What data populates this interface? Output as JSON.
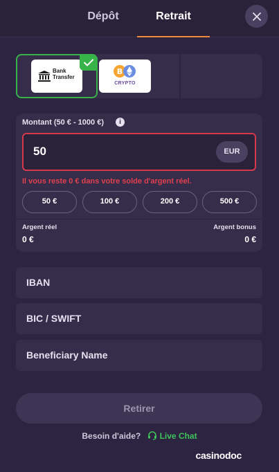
{
  "tabs": {
    "deposit": "Dépôt",
    "withdraw": "Retrait"
  },
  "methods": {
    "bank": {
      "line1": "Bank",
      "line2": "Transfer"
    },
    "crypto": {
      "label": "CRYPTO"
    }
  },
  "amount": {
    "label": "Montant (50 € - 1000 €)",
    "info_icon": "i",
    "value": "50",
    "currency": "EUR",
    "error": "Il vous reste 0 € dans votre solde d'argent réel.",
    "presets": [
      "50 €",
      "100 €",
      "200 €",
      "500 €"
    ]
  },
  "balances": {
    "real_label": "Argent réel",
    "real_value": "0 €",
    "bonus_label": "Argent bonus",
    "bonus_value": "0 €"
  },
  "fields": {
    "iban": "IBAN",
    "bic": "BIC / SWIFT",
    "beneficiary": "Beneficiary Name"
  },
  "submit": "Retirer",
  "help": {
    "question": "Besoin d'aide?",
    "live_chat": "Live Chat"
  },
  "watermark": "casinodoc",
  "colors": {
    "accent_tab": "#f08a3c",
    "selected_method": "#37b34a",
    "error": "#e0404f",
    "live_chat": "#3fc35a"
  }
}
